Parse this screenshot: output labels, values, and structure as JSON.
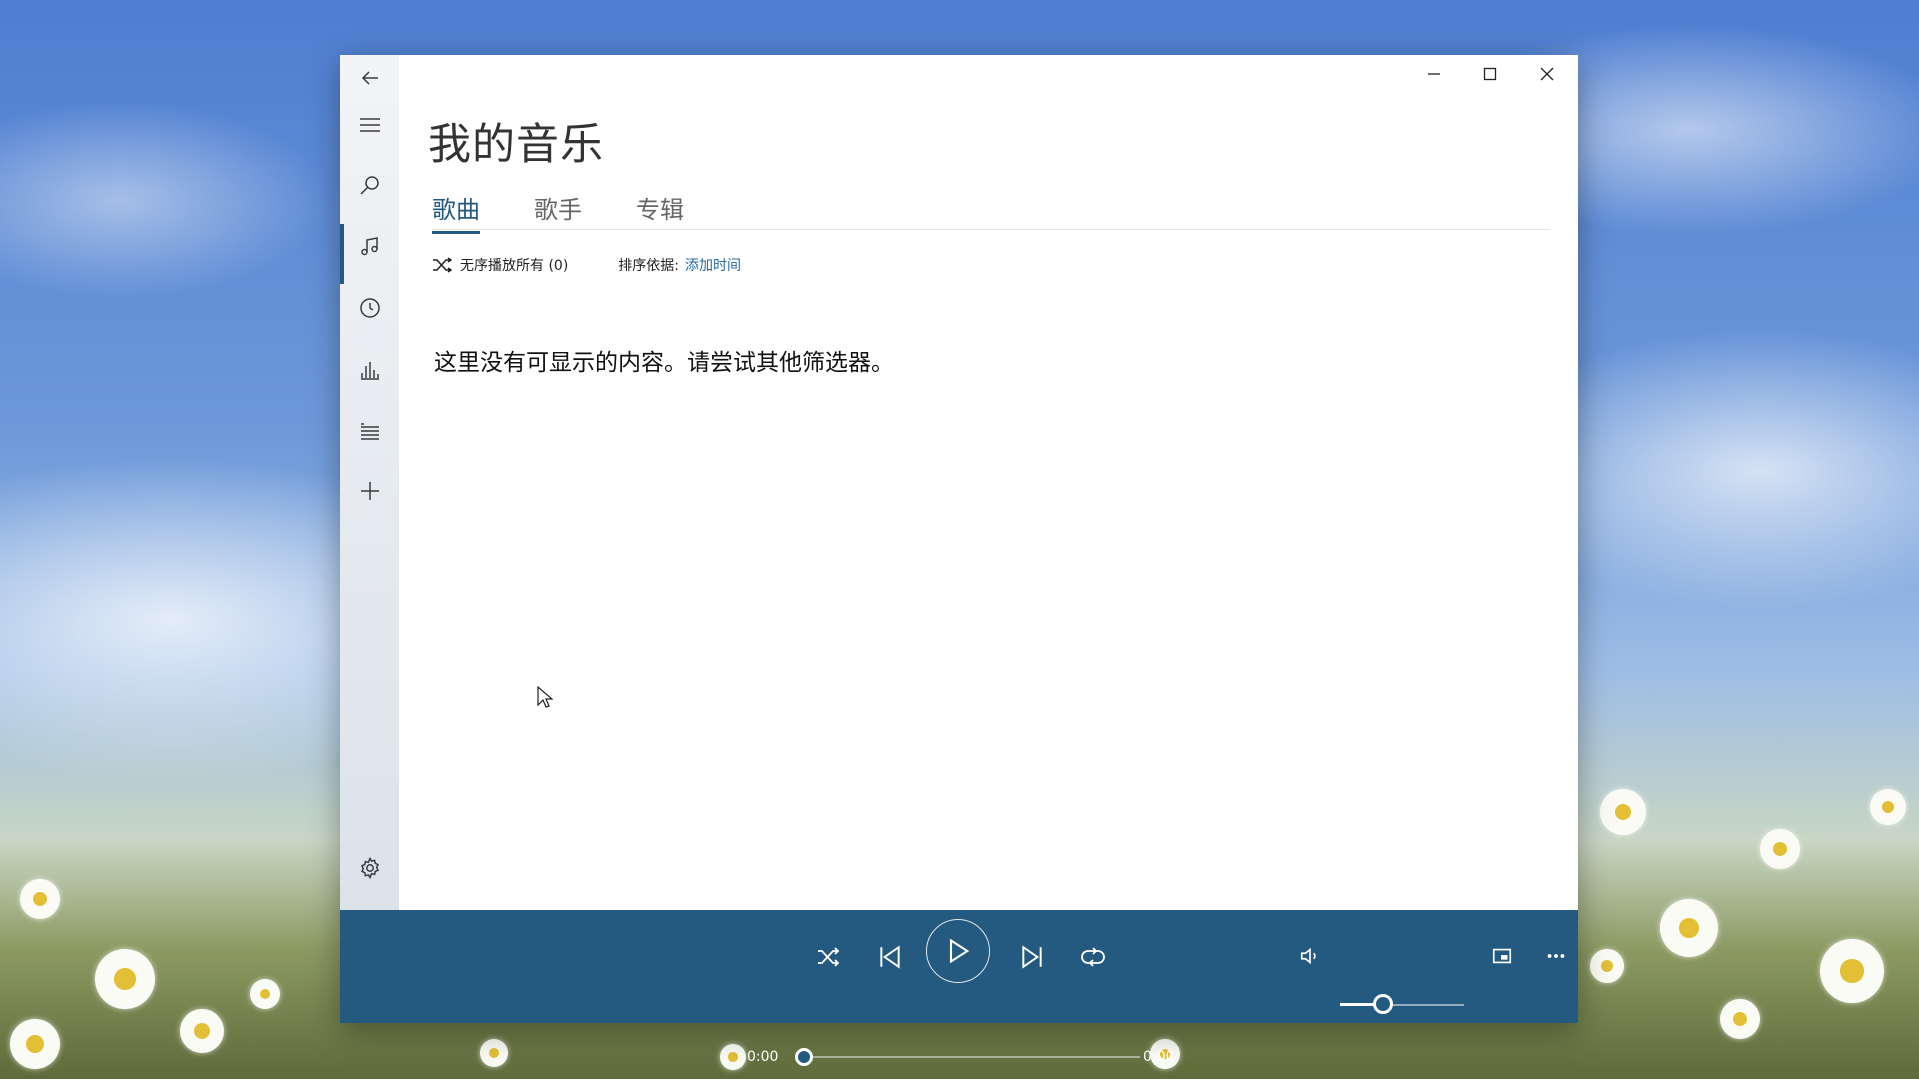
{
  "window": {
    "title": "我的音乐",
    "tabs": [
      {
        "label": "歌曲",
        "active": true
      },
      {
        "label": "歌手",
        "active": false
      },
      {
        "label": "专辑",
        "active": false
      }
    ]
  },
  "sidebar": {
    "items": [
      {
        "name": "back",
        "icon": "back-arrow-icon"
      },
      {
        "name": "menu",
        "icon": "hamburger-icon"
      },
      {
        "name": "search",
        "icon": "search-icon"
      },
      {
        "name": "my-music",
        "icon": "music-note-icon",
        "active": true
      },
      {
        "name": "recent",
        "icon": "clock-icon"
      },
      {
        "name": "now-playing",
        "icon": "equalizer-icon"
      },
      {
        "name": "playlists",
        "icon": "playlist-icon"
      },
      {
        "name": "new-playlist",
        "icon": "plus-icon"
      },
      {
        "name": "settings",
        "icon": "gear-icon"
      }
    ]
  },
  "toolbar": {
    "shuffle_all_label": "无序播放所有 (0)",
    "sort_label": "排序依据:",
    "sort_value": "添加时间"
  },
  "content": {
    "empty_message": "这里没有可显示的内容。请尝试其他筛选器。"
  },
  "player": {
    "time_elapsed": "0:00",
    "time_total": "0:00",
    "progress": 0,
    "volume": 0.35,
    "controls": [
      "shuffle-icon",
      "previous-icon",
      "play-icon",
      "next-icon",
      "repeat-icon",
      "volume-icon",
      "mini-view-icon",
      "more-icon"
    ]
  },
  "colors": {
    "accent": "#245a80",
    "link": "#2b6aa0",
    "sidebar_bg": "#e8ecf0"
  }
}
